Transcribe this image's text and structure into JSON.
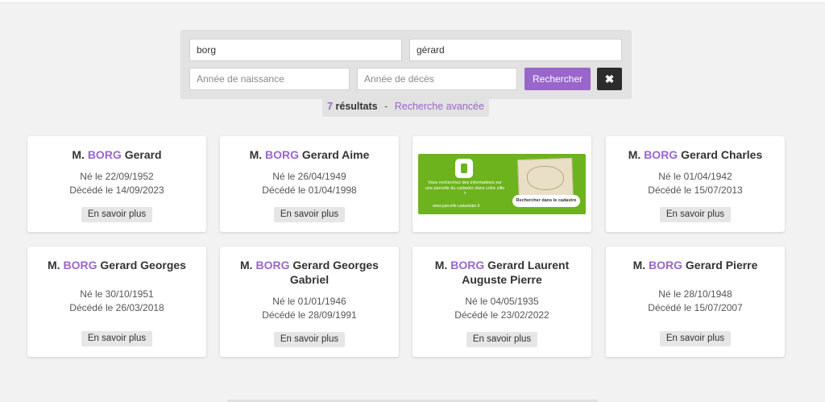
{
  "search": {
    "name_value": "borg",
    "firstname_value": "gérard",
    "birth_placeholder": "Année de naissance",
    "death_placeholder": "Année de décès",
    "search_label": "Rechercher",
    "clear_label": "✖"
  },
  "results": {
    "count": "7",
    "label": "résultats",
    "separator": "-",
    "advanced_label": "Recherche avancée"
  },
  "cards": [
    {
      "prefix": "M.",
      "surname": "BORG",
      "given": "Gerard",
      "born": "Né le 22/09/1952",
      "died": "Décédé le 14/09/2023",
      "more": "En savoir plus"
    },
    {
      "prefix": "M.",
      "surname": "BORG",
      "given": "Gerard Aime",
      "born": "Né le 26/04/1949",
      "died": "Décédé le 01/04/1998",
      "more": "En savoir plus"
    },
    {
      "prefix": "M.",
      "surname": "BORG",
      "given": "Gerard Charles",
      "born": "Né le 01/04/1942",
      "died": "Décédé le 15/07/2013",
      "more": "En savoir plus"
    },
    {
      "prefix": "M.",
      "surname": "BORG",
      "given": "Gerard Georges",
      "born": "Né le 30/10/1951",
      "died": "Décédé le 26/03/2018",
      "more": "En savoir plus"
    },
    {
      "prefix": "M.",
      "surname": "BORG",
      "given": "Gerard Georges Gabriel",
      "born": "Né le 01/01/1946",
      "died": "Décédé le 28/09/1991",
      "more": "En savoir plus"
    },
    {
      "prefix": "M.",
      "surname": "BORG",
      "given": "Gerard Laurent Auguste Pierre",
      "born": "Né le 04/05/1935",
      "died": "Décédé le 23/02/2022",
      "more": "En savoir plus"
    },
    {
      "prefix": "M.",
      "surname": "BORG",
      "given": "Gerard Pierre",
      "born": "Né le 28/10/1948",
      "died": "Décédé le 15/07/2007",
      "more": "En savoir plus"
    }
  ],
  "ad": {
    "text": "Vous recherchez des informations sur une parcelle du cadastre dans votre ville ?",
    "url": "www.parcelle-cadastrale.fr",
    "cta": "Rechercher dans le cadastre",
    "color": "#6db31d"
  },
  "colors": {
    "accent": "#9966cc",
    "dark_button": "#2c2c2c"
  }
}
